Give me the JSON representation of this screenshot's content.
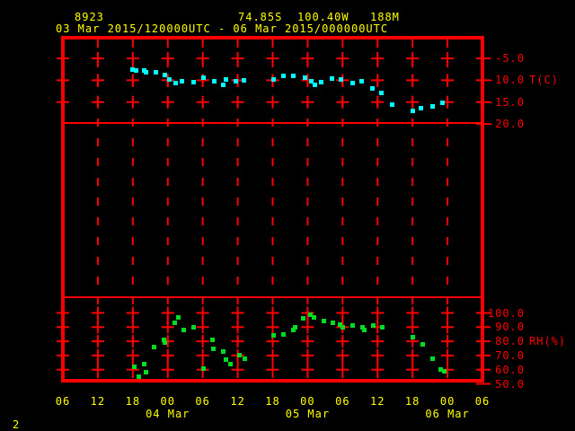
{
  "header": {
    "station_id": "8923",
    "latitude": "74.85S",
    "longitude": "100.40W",
    "elevation": "188M",
    "period": "03 Mar 2015/120000UTC - 06 Mar 2015/000000UTC"
  },
  "footer": {
    "page_number": "2"
  },
  "colors": {
    "background": "#000000",
    "grid": "#ff0000",
    "axis_text": "#ff0000",
    "header_text": "#ffff00",
    "temperature_series": "#00ffff",
    "humidity_series": "#00dd22"
  },
  "x_axis": {
    "hours_origin": "hours since 03 Mar 2015 00UTC",
    "range": [
      6,
      78
    ],
    "hour_ticks": [
      {
        "hour": 6,
        "label": "06"
      },
      {
        "hour": 12,
        "label": "12"
      },
      {
        "hour": 18,
        "label": "18"
      },
      {
        "hour": 24,
        "label": "00"
      },
      {
        "hour": 30,
        "label": "06"
      },
      {
        "hour": 36,
        "label": "12"
      },
      {
        "hour": 42,
        "label": "18"
      },
      {
        "hour": 48,
        "label": "00"
      },
      {
        "hour": 54,
        "label": "06"
      },
      {
        "hour": 60,
        "label": "12"
      },
      {
        "hour": 66,
        "label": "18"
      },
      {
        "hour": 72,
        "label": "00"
      },
      {
        "hour": 78,
        "label": "06"
      }
    ],
    "date_ticks": [
      {
        "hour": 24,
        "label": "04 Mar"
      },
      {
        "hour": 48,
        "label": "05 Mar"
      },
      {
        "hour": 72,
        "label": "06 Mar"
      }
    ]
  },
  "chart_data": [
    {
      "type": "scatter",
      "panel": "temperature",
      "ylabel": "T(C)",
      "ylabel_at_tick": -10,
      "ylim": [
        0,
        -20
      ],
      "yticks": [
        {
          "value": -5,
          "label": "-5.0"
        },
        {
          "value": -10,
          "label": "-10.0"
        },
        {
          "value": -15,
          "label": "-15.0"
        },
        {
          "value": -20,
          "label": "-20.0"
        }
      ],
      "series": [
        {
          "name": "temperature",
          "points": [
            [
              17.9,
              -7.6
            ],
            [
              18.6,
              -7.8
            ],
            [
              19.9,
              -7.8
            ],
            [
              20.3,
              -8.2
            ],
            [
              21.9,
              -8.2
            ],
            [
              23.5,
              -8.8
            ],
            [
              24.2,
              -9.9
            ],
            [
              25.4,
              -10.7
            ],
            [
              26.5,
              -10.3
            ],
            [
              28.5,
              -10.5
            ],
            [
              30.1,
              -9.5
            ],
            [
              32.0,
              -10.3
            ],
            [
              33.5,
              -11.1
            ],
            [
              34.0,
              -9.9
            ],
            [
              35.7,
              -10.3
            ],
            [
              37.0,
              -10.1
            ],
            [
              42.1,
              -9.9
            ],
            [
              43.9,
              -9.1
            ],
            [
              45.5,
              -9.1
            ],
            [
              47.6,
              -9.5
            ],
            [
              48.7,
              -10.3
            ],
            [
              49.3,
              -11.1
            ],
            [
              50.4,
              -10.5
            ],
            [
              52.2,
              -9.7
            ],
            [
              53.7,
              -9.9
            ],
            [
              55.7,
              -10.7
            ],
            [
              57.3,
              -10.3
            ],
            [
              59.1,
              -11.9
            ],
            [
              60.6,
              -12.9
            ],
            [
              62.5,
              -15.5
            ],
            [
              66.0,
              -17.1
            ],
            [
              67.5,
              -16.3
            ],
            [
              69.4,
              -15.9
            ],
            [
              71.1,
              -15.1
            ]
          ]
        }
      ]
    },
    {
      "type": "scatter",
      "panel": "relative_humidity",
      "ylabel": "RH(%)",
      "ylabel_at_tick": 80,
      "ylim": [
        110,
        50
      ],
      "yticks": [
        {
          "value": 100,
          "label": "100.0"
        },
        {
          "value": 90,
          "label": "90.0"
        },
        {
          "value": 80,
          "label": "80.0"
        },
        {
          "value": 70,
          "label": "70.0"
        },
        {
          "value": 60,
          "label": "60.0"
        },
        {
          "value": 50,
          "label": "50.0"
        }
      ],
      "series": [
        {
          "name": "relative_humidity",
          "points": [
            [
              18.2,
              62
            ],
            [
              19.1,
              55
            ],
            [
              20.0,
              64
            ],
            [
              20.2,
              58
            ],
            [
              21.7,
              76
            ],
            [
              23.4,
              81
            ],
            [
              23.5,
              79
            ],
            [
              25.2,
              93
            ],
            [
              25.8,
              97
            ],
            [
              26.8,
              88
            ],
            [
              28.5,
              90
            ],
            [
              30.1,
              61
            ],
            [
              31.7,
              81
            ],
            [
              31.8,
              75
            ],
            [
              33.5,
              73
            ],
            [
              34.0,
              67
            ],
            [
              34.7,
              64
            ],
            [
              36.3,
              70
            ],
            [
              37.2,
              68
            ],
            [
              42.2,
              84
            ],
            [
              43.8,
              85
            ],
            [
              45.5,
              88
            ],
            [
              45.8,
              90
            ],
            [
              47.3,
              96
            ],
            [
              48.4,
              99
            ],
            [
              49.1,
              97
            ],
            [
              50.8,
              94
            ],
            [
              52.4,
              93
            ],
            [
              53.6,
              92
            ],
            [
              54.0,
              90
            ],
            [
              55.7,
              91
            ],
            [
              57.4,
              90
            ],
            [
              57.7,
              88
            ],
            [
              59.3,
              91
            ],
            [
              60.8,
              90
            ],
            [
              66.0,
              83
            ],
            [
              67.7,
              78
            ],
            [
              69.4,
              68
            ],
            [
              70.9,
              60
            ],
            [
              71.5,
              59
            ]
          ]
        }
      ]
    }
  ]
}
